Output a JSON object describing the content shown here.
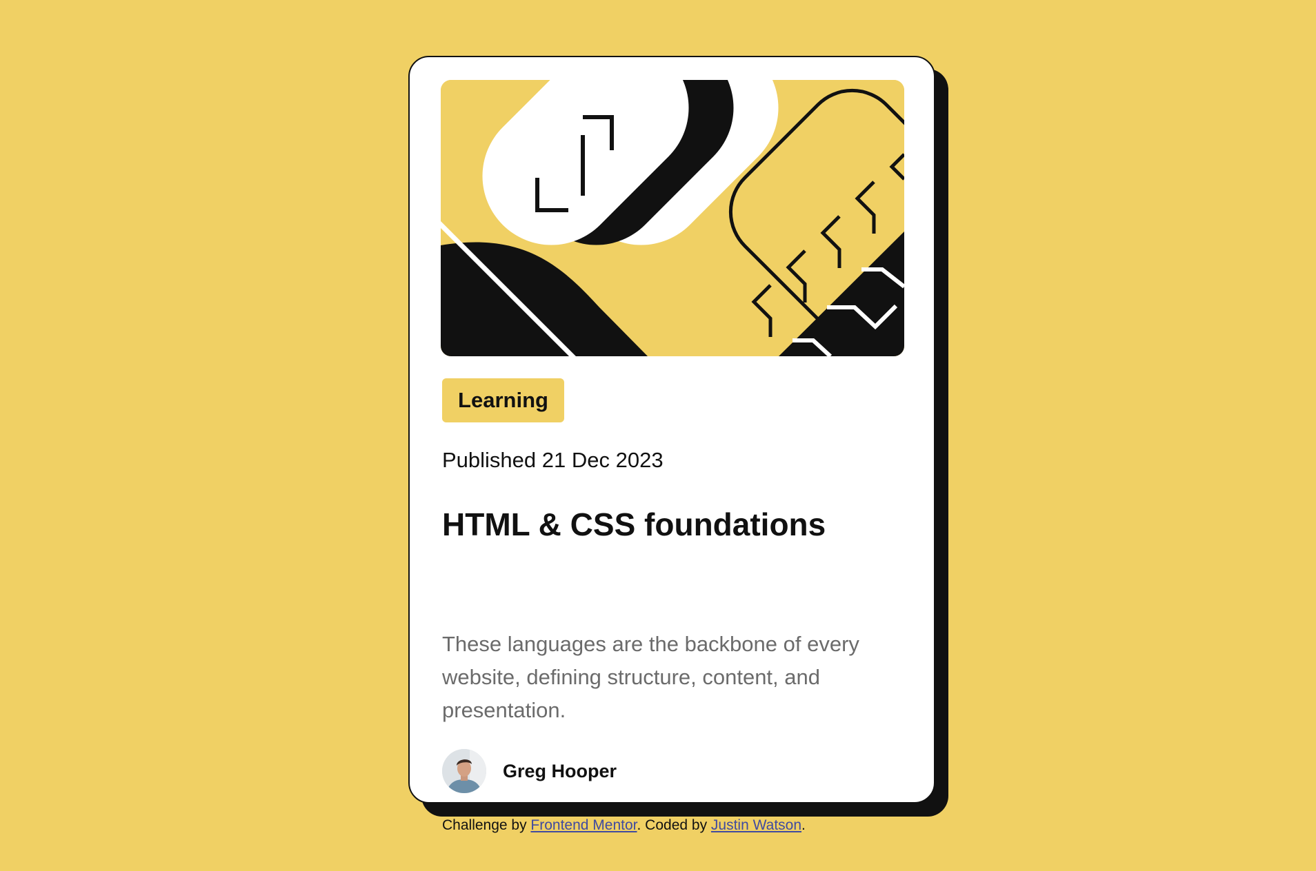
{
  "page": {
    "background_color": "#F0D064",
    "accent_color": "#F0D064",
    "text_color": "#111111",
    "muted_text_color": "#6B6B6B",
    "link_color": "#3F4AA0"
  },
  "card": {
    "hero_image": "abstract-illustration",
    "tag": "Learning",
    "published": "Published 21 Dec 2023",
    "title": "HTML & CSS foundations",
    "description": "These languages are the backbone of every website, defining structure, content, and presentation.",
    "author": {
      "name": "Greg Hooper",
      "avatar": "author-avatar"
    }
  },
  "attribution": {
    "prefix": "Challenge by ",
    "link1": "Frontend Mentor",
    "middle": ". Coded by ",
    "link2": "Justin Watson",
    "suffix": "."
  }
}
